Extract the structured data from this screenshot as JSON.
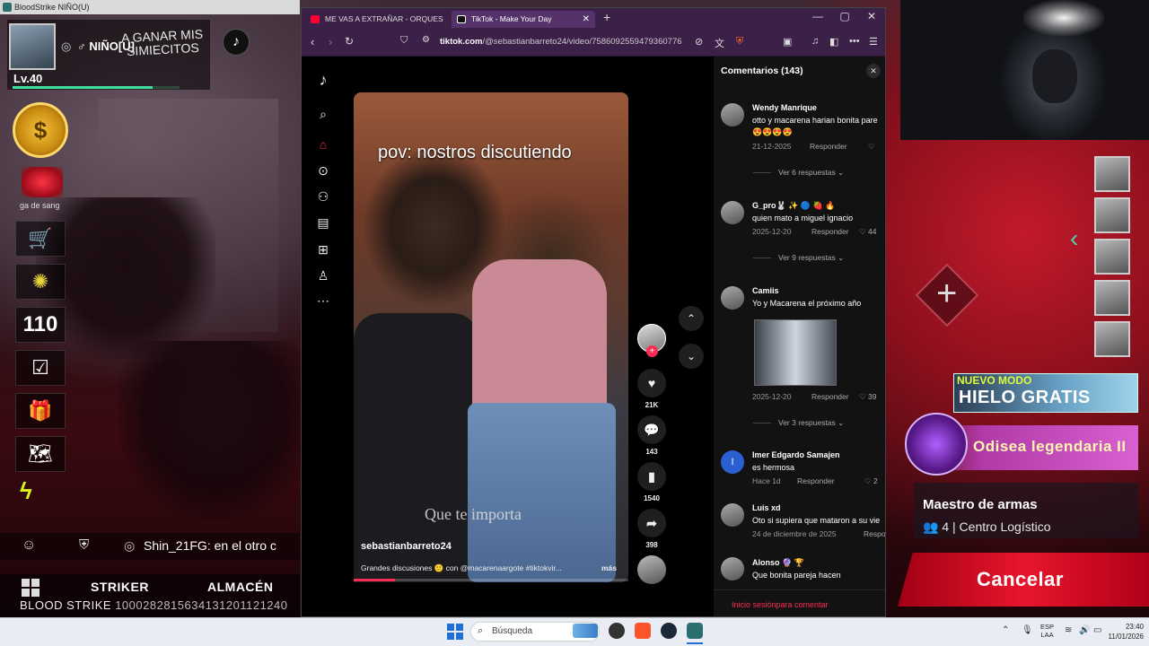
{
  "game": {
    "window_title": "BloodStrike NIÑO(U)",
    "player": {
      "name": "♂ NIÑO[U]",
      "motto": "A GANAR MIS SIMIECITOS",
      "level": "Lv.40",
      "level_progress": 0.84
    },
    "blood_label": "ga de sang",
    "counter": "110",
    "chat": {
      "sender": "Shin_21FG:",
      "message": "en el otro c"
    },
    "nav_tabs": [
      "STRIKER",
      "ALMACÉN"
    ],
    "footer": {
      "brand": "BLOOD STRIKE",
      "id": "1000282815634131201121240"
    },
    "mode_banner": {
      "tag": "NUEVO MODO",
      "title": "HIELO GRATIS"
    },
    "odisea_title": "Odisea legendaria II",
    "maestro": {
      "title": "Maestro de armas",
      "count": "4",
      "location": "Centro Logístico"
    },
    "cancel_label": "Cancelar",
    "icons": [
      "tiktok-icon",
      "coin-icon",
      "cart-icon",
      "wheel-icon",
      "checklist-icon",
      "gift-icon",
      "map-icon",
      "strike-pass-icon",
      "emoji-icon",
      "shield-icon",
      "globe-icon",
      "grid-icon",
      "plus-icon",
      "chevron-left-icon"
    ]
  },
  "browser": {
    "tabs": [
      {
        "label": "ME VAS A EXTRAÑAR - ORQUES",
        "color": "#ff0033"
      },
      {
        "label": "TikTok - Make Your Day",
        "color": "#ffffff"
      }
    ],
    "new_tab": "+",
    "url_domain": "tiktok.com",
    "url_path": "/@sebastianbarreto24/video/7586092559479360776",
    "window_controls": [
      "—",
      "▢",
      "✕"
    ]
  },
  "tiktok": {
    "nav_icons": [
      "tiktok-logo-icon",
      "search-icon",
      "home-icon",
      "explore-icon",
      "following-icon",
      "live-icon",
      "upload-icon",
      "profile-icon",
      "more-icon"
    ],
    "video": {
      "caption_top": "pov: nostros discutiendo",
      "overlay_text": "Que te importa",
      "author": "sebastianbarreto24",
      "description": "Grandes discusiones 🙂 con @macarenaargote #tiktokvir...",
      "more": "más",
      "progress": 0.15
    },
    "actions": {
      "likes": "21K",
      "comments": "143",
      "saves": "1540",
      "shares": "398"
    }
  },
  "comments": {
    "title": "Comentarios (143)",
    "items": [
      {
        "name": "Wendy Manrique",
        "text": "otto y macarena harian bonita pare",
        "emoji": "😍😍😍😍",
        "date": "21-12-2025",
        "reply": "Responder",
        "likes": "",
        "replies": "Ver 6 respuestas"
      },
      {
        "name": "G_pro🐰 ✨ 🔵 🍓 🔥",
        "text": "quien mato a miguel ignacio",
        "date": "2025-12-20",
        "reply": "Responder",
        "likes": "44",
        "replies": "Ver 9 respuestas"
      },
      {
        "name": "Camiis",
        "text": "Yo y Macarena el próximo año",
        "date": "2025-12-20",
        "reply": "Responder",
        "likes": "39",
        "replies": "Ver 3 respuestas"
      },
      {
        "name": "Imer Edgardo Samajen",
        "text": "es hermosa",
        "date": "Hace 1d",
        "reply": "Responder",
        "likes": "2",
        "initial": "I"
      },
      {
        "name": "Luis xd",
        "text": "Oto si supiera que mataron a su vie",
        "date": "24 de diciembre de 2025",
        "reply": "Respo"
      },
      {
        "name": "Alonso 🔮 🏆",
        "text": "Que bonita pareja hacen"
      }
    ],
    "login_prompt": "Inicio sesiónpara comentar"
  },
  "taskbar": {
    "search_placeholder": "Búsqueda",
    "lang": "ESP",
    "lang_sub": "LAA",
    "time": "23:40",
    "date": "11/01/2026"
  }
}
